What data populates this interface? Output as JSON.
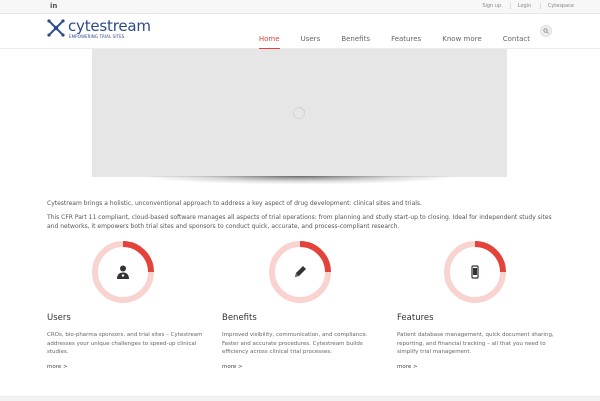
{
  "topbar": {
    "social": "in",
    "links": [
      "Sign up",
      "Login",
      "Cytespace"
    ]
  },
  "brand": {
    "name": "cytestream",
    "tagline": "EMPOWERING TRIAL SITES",
    "color": "#2d4a8a"
  },
  "nav": {
    "items": [
      "Home",
      "Users",
      "Benefits",
      "Features",
      "Know more",
      "Contact"
    ],
    "active": "Home",
    "search_icon": "search-icon"
  },
  "intro": {
    "p1": "Cytestream brings a holistic, unconventional approach to address a key aspect of drug development: clinical sites and trials.",
    "p2": "This CFR Part 11 compliant, cloud-based software manages all aspects of trial operations: from planning and study start-up to closing. Ideal for independent study sites and networks, it empowers both trial sites and sponsors to conduct quick, accurate, and process-compliant research."
  },
  "features": [
    {
      "icon": "doctor-icon",
      "title": "Users",
      "desc": "CROs, bio-pharma sponsors, and trial sites – Cytestream addresses your unique challenges to speed-up clinical studies.",
      "more": "more >"
    },
    {
      "icon": "pencil-icon",
      "title": "Benefits",
      "desc": "Improved visibility, communication, and compliance. Faster and accurate procedures. Cytestream builds efficiency across clinical trial processes.",
      "more": "more >"
    },
    {
      "icon": "mobile-icon",
      "title": "Features",
      "desc": "Patient database management, quick document sharing, reporting, and financial tracking – all that you need to simplify trial management.",
      "more": "more >"
    }
  ],
  "colors": {
    "accent": "#e3433a",
    "ring_track": "#f9d3cf"
  }
}
